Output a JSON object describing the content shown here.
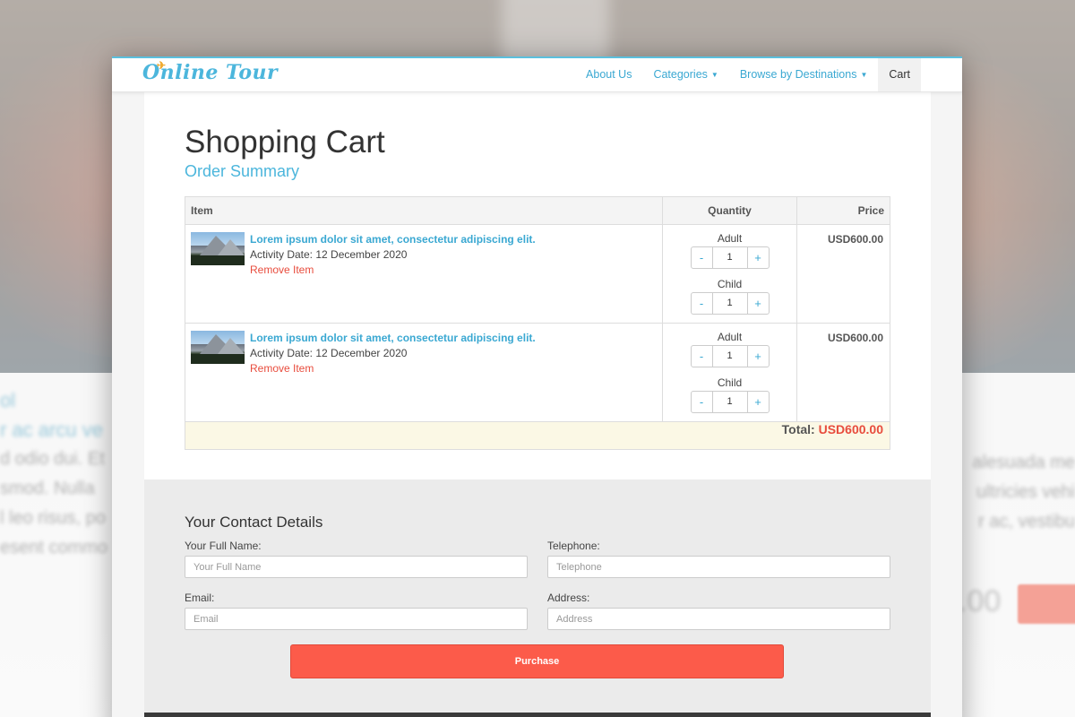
{
  "brand": {
    "name": "Online Tour"
  },
  "nav": [
    {
      "label": "About Us",
      "caret": false,
      "active": false
    },
    {
      "label": "Categories",
      "caret": true,
      "active": false
    },
    {
      "label": "Browse by Destinations",
      "caret": true,
      "active": false
    },
    {
      "label": "Cart",
      "caret": false,
      "active": true
    }
  ],
  "page": {
    "title": "Shopping Cart",
    "subtitle": "Order Summary"
  },
  "cart": {
    "headers": {
      "item": "Item",
      "quantity": "Quantity",
      "price": "Price"
    },
    "items": [
      {
        "name": "Lorem ipsum dolor sit amet, consectetur adipiscing elit.",
        "date": "Activity Date: 12 December 2020",
        "remove": "Remove Item",
        "adult_label": "Adult",
        "adult_qty": "1",
        "child_label": "Child",
        "child_qty": "1",
        "price": "USD600.00"
      },
      {
        "name": "Lorem ipsum dolor sit amet, consectetur adipiscing elit.",
        "date": "Activity Date: 12 December 2020",
        "remove": "Remove Item",
        "adult_label": "Adult",
        "adult_qty": "1",
        "child_label": "Child",
        "child_qty": "1",
        "price": "USD600.00"
      }
    ],
    "stepper": {
      "minus": "-",
      "plus": "+"
    },
    "total_label": "Total:",
    "total_value": "USD600.00"
  },
  "contact": {
    "heading": "Your Contact Details",
    "full_name": {
      "label": "Your Full Name:",
      "placeholder": "Your Full Name"
    },
    "telephone": {
      "label": "Telephone:",
      "placeholder": "Telephone"
    },
    "email": {
      "label": "Email:",
      "placeholder": "Email"
    },
    "address": {
      "label": "Address:",
      "placeholder": "Address"
    },
    "purchase": "Purchase"
  },
  "colors": {
    "accent": "#4cb6dc",
    "danger": "#e84c3d",
    "purchase": "#fc5b4a"
  }
}
